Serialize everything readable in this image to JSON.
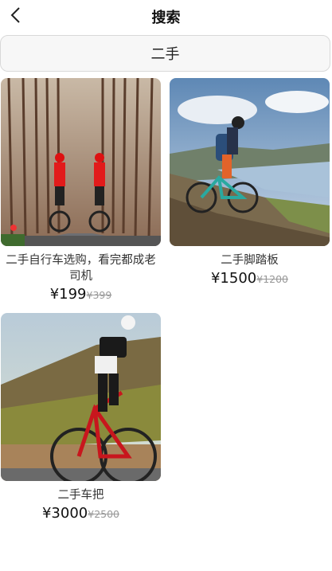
{
  "header": {
    "title": "搜索",
    "back_icon": "chevron-left-icon"
  },
  "search": {
    "query": "二手"
  },
  "products": [
    {
      "title": "二手自行车选购，看完都成老司机",
      "price": "¥199",
      "original_price": "¥399",
      "image": "cyclists-in-forest-road"
    },
    {
      "title": "二手脚踏板",
      "price": "¥1500",
      "original_price": "¥1200",
      "image": "mountain-biker-on-hill"
    },
    {
      "title": "二手车把",
      "price": "¥3000",
      "original_price": "¥2500",
      "image": "road-cyclist-red-bike"
    }
  ]
}
